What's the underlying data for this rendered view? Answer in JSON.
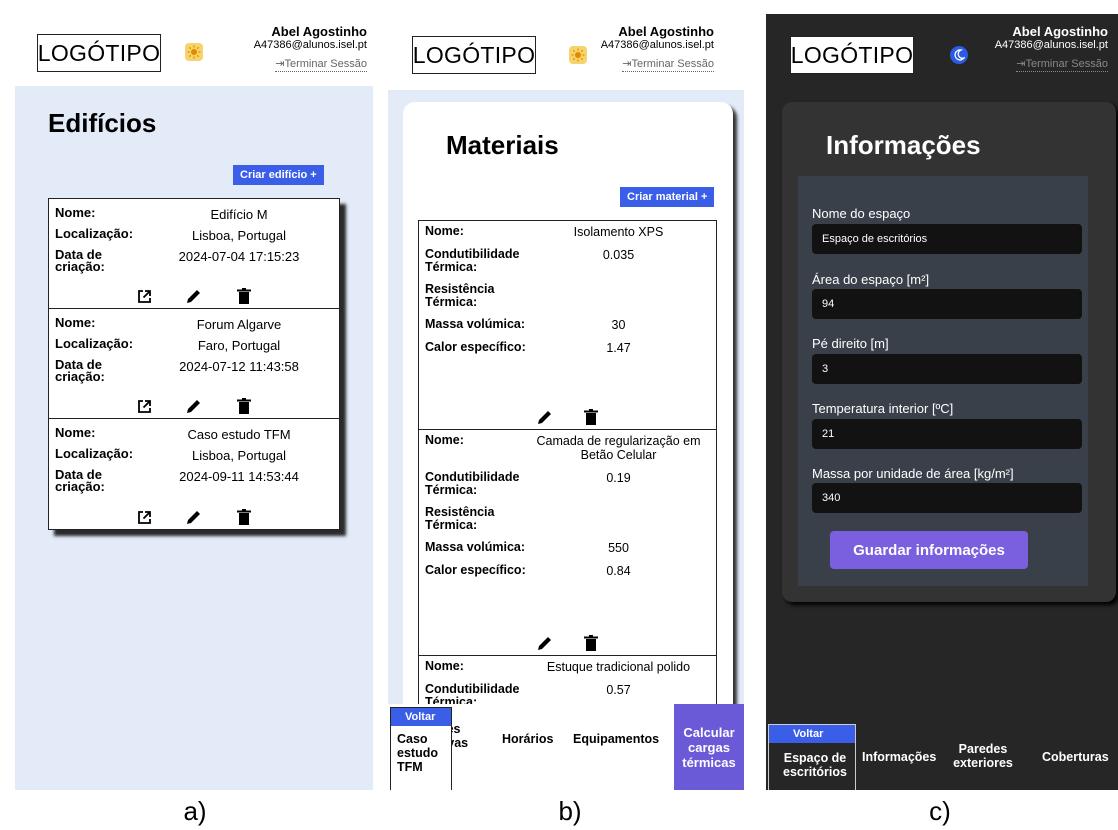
{
  "header": {
    "logo": "LOGÓTIPO",
    "user_name": "Abel Agostinho",
    "user_email": "A47386@alunos.isel.pt",
    "logout": "Terminar Sessão"
  },
  "panel_a": {
    "title": "Edifícios",
    "create_button": "Criar edifício +",
    "field_labels": {
      "name": "Nome:",
      "location": "Localização:",
      "created": "Data de criação:"
    },
    "buildings": [
      {
        "name": "Edifício M",
        "location": "Lisboa, Portugal",
        "created": "2024-07-04 17:15:23"
      },
      {
        "name": "Forum Algarve",
        "location": "Faro, Portugal",
        "created": "2024-07-12 11:43:58"
      },
      {
        "name": "Caso estudo TFM",
        "location": "Lisboa, Portugal",
        "created": "2024-09-11 14:53:44"
      }
    ],
    "caption": "a)"
  },
  "panel_b": {
    "title": "Materiais",
    "create_button": "Criar material +",
    "field_labels": {
      "name": "Nome:",
      "conductivity": "Condutibilidade Térmica:",
      "resistance": "Resistência Térmica:",
      "density": "Massa volúmica:",
      "heat": "Calor específico:"
    },
    "materials": [
      {
        "name": "Isolamento XPS",
        "conductivity": "0.035",
        "resistance": "",
        "density": "30",
        "heat": "1.47"
      },
      {
        "name": "Camada de regularização em Betão Celular",
        "conductivity": "0.19",
        "resistance": "",
        "density": "550",
        "heat": "0.84"
      },
      {
        "name": "Estuque tradicional polido",
        "conductivity": "0.57",
        "resistance": "",
        "density": "",
        "heat": ""
      }
    ],
    "voltar": "Voltar",
    "voltar_sub": "Caso estudo TFM",
    "nav": [
      "ções\nutivas",
      "Horários",
      "Equipamentos"
    ],
    "calc_button": "Calcular cargas térmicas",
    "caption": "b)"
  },
  "panel_c": {
    "title": "Informações",
    "fields": [
      {
        "label": "Nome do espaço",
        "value": "Espaço de escritórios"
      },
      {
        "label": "Área do espaço [m²]",
        "value": "94"
      },
      {
        "label": "Pé direito [m]",
        "value": "3"
      },
      {
        "label": "Temperatura interior [ºC]",
        "value": "21"
      },
      {
        "label": "Massa por unidade de área [kg/m²]",
        "value": "340"
      }
    ],
    "save_button": "Guardar informações",
    "voltar": "Voltar",
    "voltar_sub": "Espaço de escritórios",
    "nav": [
      "Informações",
      "Paredes exteriores",
      "Coberturas"
    ],
    "caption": "c)"
  },
  "colors": {
    "accent": "#3b5ee9",
    "purple": "#6a5ad8",
    "light_bg": "#e3eaf8",
    "dark_bg": "#262626"
  },
  "icons": {
    "sun": "sun-icon",
    "moon": "moon-icon",
    "open": "open-external-icon",
    "edit": "pencil-icon",
    "delete": "trash-icon",
    "logout": "logout-icon"
  }
}
